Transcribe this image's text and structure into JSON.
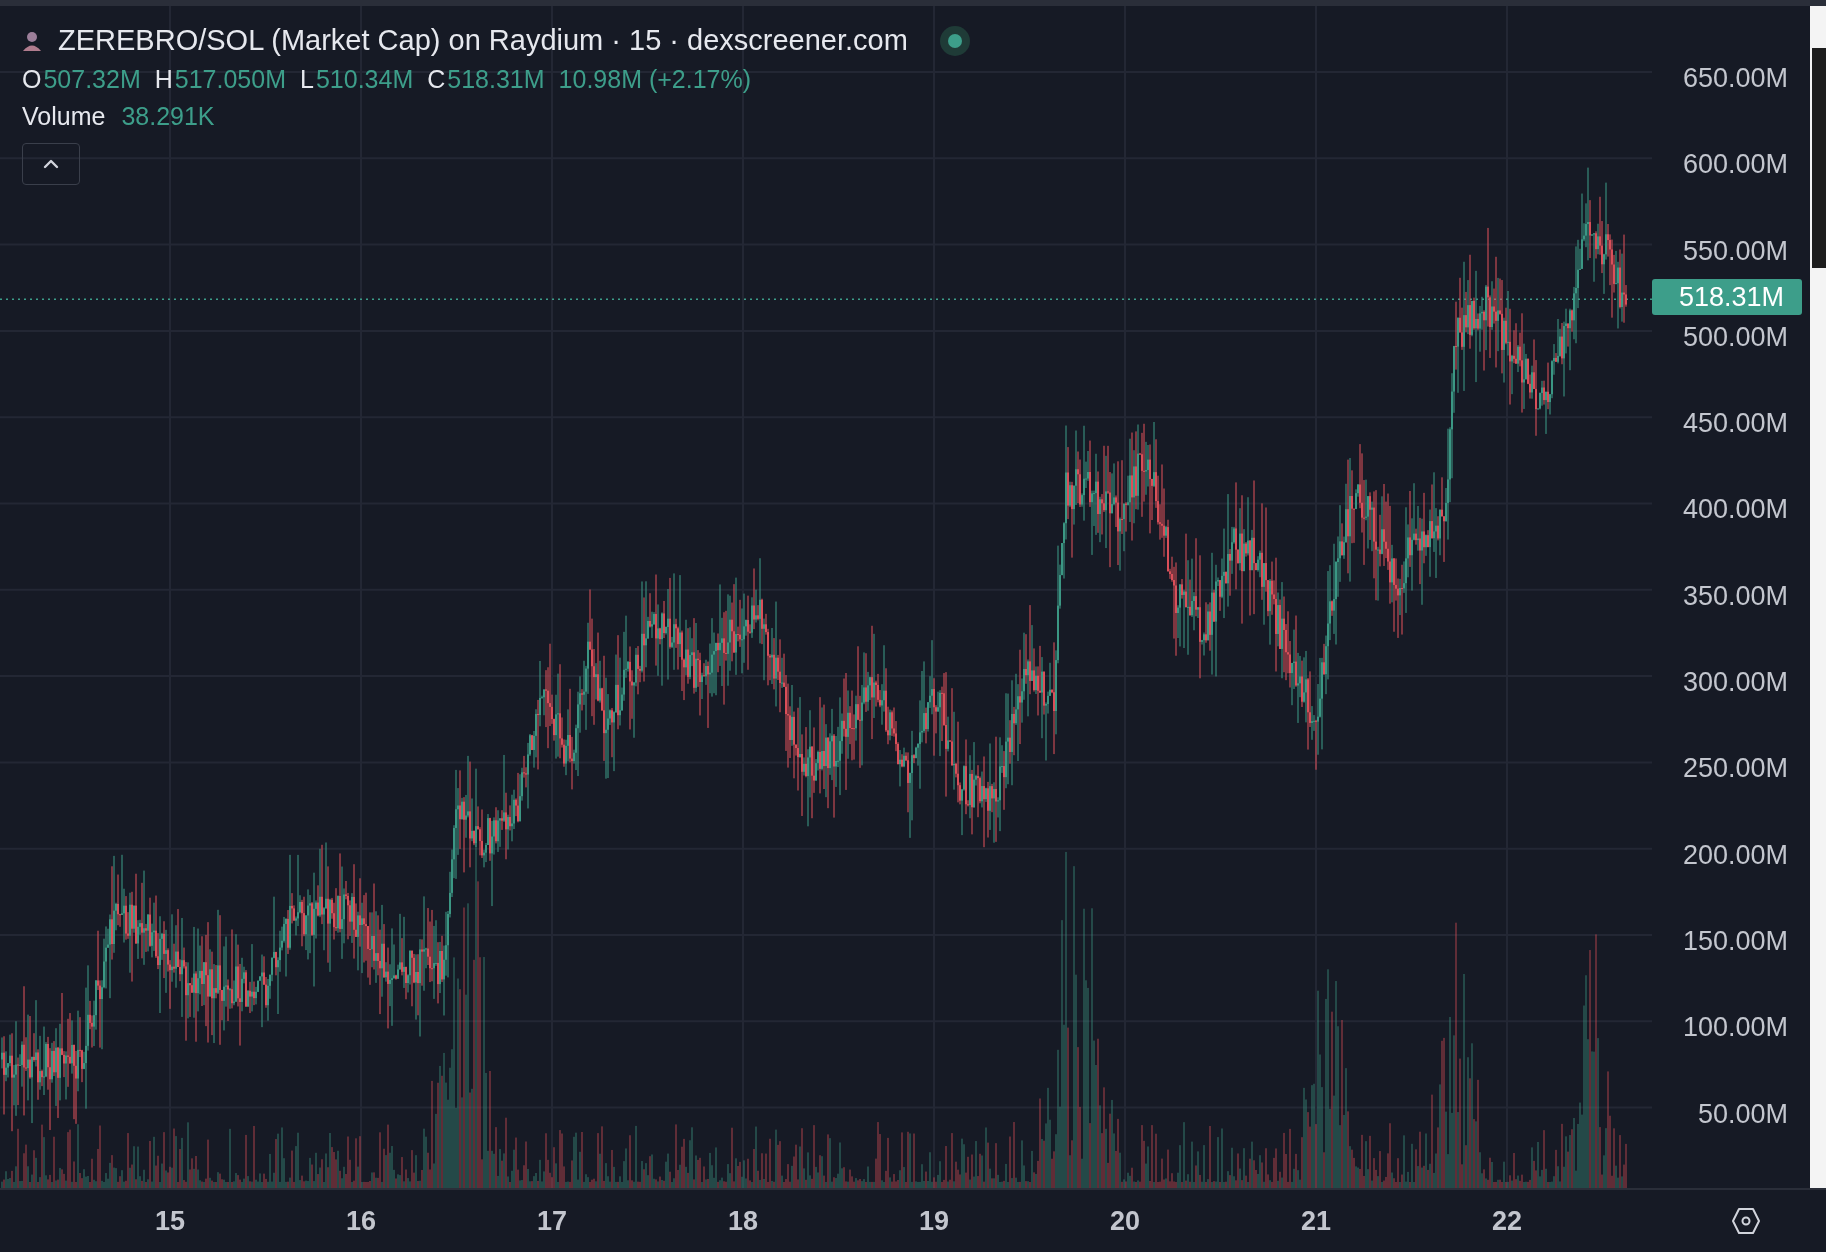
{
  "legend": {
    "title": "ZEREBRO/SOL (Market Cap) on Raydium · 15 · dexscreener.com",
    "ohlc": [
      {
        "label": "O",
        "value": "507.32M"
      },
      {
        "label": "H",
        "value": "517.050M"
      },
      {
        "label": "L",
        "value": "510.34M"
      },
      {
        "label": "C",
        "value": "518.31M"
      }
    ],
    "change": "10.98M (+2.17%)",
    "volume": {
      "label": "Volume",
      "value": "38.291K"
    }
  },
  "price_axis": {
    "labels": [
      "650.00M",
      "600.00M",
      "550.00M",
      "500.00M",
      "450.00M",
      "400.00M",
      "350.00M",
      "300.00M",
      "250.00M",
      "200.00M",
      "150.00M",
      "100.00M",
      "50.00M"
    ],
    "last_price": "518.31M"
  },
  "time_axis": {
    "labels": [
      "15",
      "16",
      "17",
      "18",
      "19",
      "20",
      "21",
      "22"
    ]
  }
}
